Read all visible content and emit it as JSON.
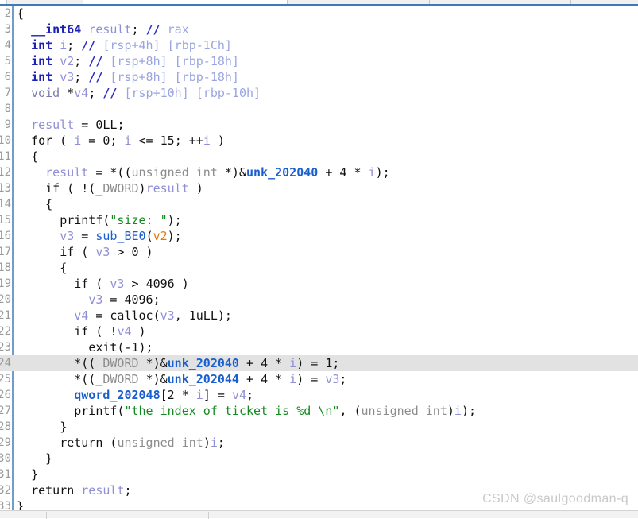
{
  "app": {
    "name": "ida-pseudocode-view",
    "accent_color": "#3a7cb8",
    "background": "#ffffff",
    "highlight_color": "#e2e2e2"
  },
  "topbar": {
    "present": true,
    "divider_color": "#c8c8c8",
    "underline_color": "#3a7cb8"
  },
  "bottombar": {
    "present": true,
    "divider_color": "#cfcfcf"
  },
  "editor": {
    "gutter_border_color": "#6f9fc8",
    "highlighted_line": 24,
    "first_visible_line": 2,
    "last_visible_line": 33
  },
  "watermark": {
    "text": "CSDN @saulgoodman-q",
    "color": "#c9c9c9"
  },
  "code_lines": [
    {
      "n": "2",
      "indent": 0,
      "tokens": [
        {
          "t": "{",
          "c": "ctl"
        }
      ]
    },
    {
      "n": "3",
      "indent": 2,
      "tokens": [
        {
          "t": "__int64",
          "c": "kw"
        },
        {
          "t": " ",
          "c": "pun"
        },
        {
          "t": "result",
          "c": "var"
        },
        {
          "t": ";",
          "c": "pun"
        },
        {
          "t": " ",
          "c": "pun"
        },
        {
          "t": "//",
          "c": "cmt"
        },
        {
          "t": " rax",
          "c": "cmtx"
        }
      ]
    },
    {
      "n": "4",
      "indent": 2,
      "tokens": [
        {
          "t": "int",
          "c": "kw"
        },
        {
          "t": " ",
          "c": "pun"
        },
        {
          "t": "i",
          "c": "var"
        },
        {
          "t": ";",
          "c": "pun"
        },
        {
          "t": " ",
          "c": "pun"
        },
        {
          "t": "//",
          "c": "cmt"
        },
        {
          "t": " [rsp+4h] [rbp-1Ch]",
          "c": "cmtx"
        }
      ]
    },
    {
      "n": "5",
      "indent": 2,
      "tokens": [
        {
          "t": "int",
          "c": "kw"
        },
        {
          "t": " ",
          "c": "pun"
        },
        {
          "t": "v2",
          "c": "var"
        },
        {
          "t": ";",
          "c": "pun"
        },
        {
          "t": " ",
          "c": "pun"
        },
        {
          "t": "//",
          "c": "cmt"
        },
        {
          "t": " [rsp+8h] [rbp-18h]",
          "c": "cmtx"
        }
      ]
    },
    {
      "n": "6",
      "indent": 2,
      "tokens": [
        {
          "t": "int",
          "c": "kw"
        },
        {
          "t": " ",
          "c": "pun"
        },
        {
          "t": "v3",
          "c": "var"
        },
        {
          "t": ";",
          "c": "pun"
        },
        {
          "t": " ",
          "c": "pun"
        },
        {
          "t": "//",
          "c": "cmt"
        },
        {
          "t": " [rsp+8h] [rbp-18h]",
          "c": "cmtx"
        }
      ]
    },
    {
      "n": "7",
      "indent": 2,
      "tokens": [
        {
          "t": "void",
          "c": "kw2"
        },
        {
          "t": " *",
          "c": "pun"
        },
        {
          "t": "v4",
          "c": "var"
        },
        {
          "t": ";",
          "c": "pun"
        },
        {
          "t": " ",
          "c": "pun"
        },
        {
          "t": "//",
          "c": "cmt"
        },
        {
          "t": " [rsp+10h] [rbp-10h]",
          "c": "cmtx"
        }
      ]
    },
    {
      "n": "8",
      "indent": 0,
      "tokens": []
    },
    {
      "n": "9",
      "indent": 2,
      "tokens": [
        {
          "t": "result",
          "c": "var"
        },
        {
          "t": " = ",
          "c": "pun"
        },
        {
          "t": "0LL",
          "c": "num"
        },
        {
          "t": ";",
          "c": "pun"
        }
      ]
    },
    {
      "n": "10",
      "indent": 2,
      "tokens": [
        {
          "t": "for",
          "c": "ctl"
        },
        {
          "t": " ( ",
          "c": "pun"
        },
        {
          "t": "i",
          "c": "var"
        },
        {
          "t": " = ",
          "c": "pun"
        },
        {
          "t": "0",
          "c": "num"
        },
        {
          "t": "; ",
          "c": "pun"
        },
        {
          "t": "i",
          "c": "var"
        },
        {
          "t": " <= ",
          "c": "pun"
        },
        {
          "t": "15",
          "c": "num"
        },
        {
          "t": "; ++",
          "c": "pun"
        },
        {
          "t": "i",
          "c": "var"
        },
        {
          "t": " )",
          "c": "pun"
        }
      ]
    },
    {
      "n": "11",
      "indent": 2,
      "tokens": [
        {
          "t": "{",
          "c": "ctl"
        }
      ]
    },
    {
      "n": "12",
      "indent": 4,
      "tokens": [
        {
          "t": "result",
          "c": "var"
        },
        {
          "t": " = *((",
          "c": "pun"
        },
        {
          "t": "unsigned int",
          "c": "typ"
        },
        {
          "t": " *)&",
          "c": "pun"
        },
        {
          "t": "unk_202040",
          "c": "glob"
        },
        {
          "t": " + ",
          "c": "pun"
        },
        {
          "t": "4",
          "c": "num"
        },
        {
          "t": " * ",
          "c": "pun"
        },
        {
          "t": "i",
          "c": "var"
        },
        {
          "t": ");",
          "c": "pun"
        }
      ]
    },
    {
      "n": "13",
      "indent": 4,
      "tokens": [
        {
          "t": "if",
          "c": "ctl"
        },
        {
          "t": " ( !(",
          "c": "pun"
        },
        {
          "t": "_DWORD",
          "c": "typ"
        },
        {
          "t": ")",
          "c": "pun"
        },
        {
          "t": "result",
          "c": "var"
        },
        {
          "t": " )",
          "c": "pun"
        }
      ]
    },
    {
      "n": "14",
      "indent": 4,
      "tokens": [
        {
          "t": "{",
          "c": "ctl"
        }
      ]
    },
    {
      "n": "15",
      "indent": 6,
      "tokens": [
        {
          "t": "printf",
          "c": "ctl"
        },
        {
          "t": "(",
          "c": "pun"
        },
        {
          "t": "\"size: \"",
          "c": "str"
        },
        {
          "t": ");",
          "c": "pun"
        }
      ]
    },
    {
      "n": "16",
      "indent": 6,
      "tokens": [
        {
          "t": "v3",
          "c": "var"
        },
        {
          "t": " = ",
          "c": "pun"
        },
        {
          "t": "sub_BE0",
          "c": "fn"
        },
        {
          "t": "(",
          "c": "pun"
        },
        {
          "t": "v2",
          "c": "varh"
        },
        {
          "t": ");",
          "c": "pun"
        }
      ]
    },
    {
      "n": "17",
      "indent": 6,
      "tokens": [
        {
          "t": "if",
          "c": "ctl"
        },
        {
          "t": " ( ",
          "c": "pun"
        },
        {
          "t": "v3",
          "c": "var"
        },
        {
          "t": " > ",
          "c": "pun"
        },
        {
          "t": "0",
          "c": "num"
        },
        {
          "t": " )",
          "c": "pun"
        }
      ]
    },
    {
      "n": "18",
      "indent": 6,
      "tokens": [
        {
          "t": "{",
          "c": "ctl"
        }
      ]
    },
    {
      "n": "19",
      "indent": 8,
      "tokens": [
        {
          "t": "if",
          "c": "ctl"
        },
        {
          "t": " ( ",
          "c": "pun"
        },
        {
          "t": "v3",
          "c": "var"
        },
        {
          "t": " > ",
          "c": "pun"
        },
        {
          "t": "4096",
          "c": "num"
        },
        {
          "t": " )",
          "c": "pun"
        }
      ]
    },
    {
      "n": "20",
      "indent": 10,
      "tokens": [
        {
          "t": "v3",
          "c": "var"
        },
        {
          "t": " = ",
          "c": "pun"
        },
        {
          "t": "4096",
          "c": "num"
        },
        {
          "t": ";",
          "c": "pun"
        }
      ]
    },
    {
      "n": "21",
      "indent": 8,
      "tokens": [
        {
          "t": "v4",
          "c": "var"
        },
        {
          "t": " = ",
          "c": "pun"
        },
        {
          "t": "calloc",
          "c": "ctl"
        },
        {
          "t": "(",
          "c": "pun"
        },
        {
          "t": "v3",
          "c": "var"
        },
        {
          "t": ", ",
          "c": "pun"
        },
        {
          "t": "1uLL",
          "c": "num"
        },
        {
          "t": ");",
          "c": "pun"
        }
      ]
    },
    {
      "n": "22",
      "indent": 8,
      "tokens": [
        {
          "t": "if",
          "c": "ctl"
        },
        {
          "t": " ( !",
          "c": "pun"
        },
        {
          "t": "v4",
          "c": "var"
        },
        {
          "t": " )",
          "c": "pun"
        }
      ]
    },
    {
      "n": "23",
      "indent": 10,
      "tokens": [
        {
          "t": "exit",
          "c": "ctl"
        },
        {
          "t": "(-",
          "c": "pun"
        },
        {
          "t": "1",
          "c": "num"
        },
        {
          "t": ");",
          "c": "pun"
        }
      ]
    },
    {
      "n": "24",
      "indent": 8,
      "highlight": true,
      "tokens": [
        {
          "t": "*((",
          "c": "pun"
        },
        {
          "t": "_DWORD",
          "c": "typ"
        },
        {
          "t": " *)&",
          "c": "pun"
        },
        {
          "t": "unk_202040",
          "c": "glob"
        },
        {
          "t": " + ",
          "c": "pun"
        },
        {
          "t": "4",
          "c": "num"
        },
        {
          "t": " * ",
          "c": "pun"
        },
        {
          "t": "i",
          "c": "var"
        },
        {
          "t": ") = ",
          "c": "pun"
        },
        {
          "t": "1",
          "c": "num"
        },
        {
          "t": ";",
          "c": "pun"
        }
      ]
    },
    {
      "n": "25",
      "indent": 8,
      "tokens": [
        {
          "t": "*((",
          "c": "pun"
        },
        {
          "t": "_DWORD",
          "c": "typ"
        },
        {
          "t": " *)&",
          "c": "pun"
        },
        {
          "t": "unk_202044",
          "c": "glob"
        },
        {
          "t": " + ",
          "c": "pun"
        },
        {
          "t": "4",
          "c": "num"
        },
        {
          "t": " * ",
          "c": "pun"
        },
        {
          "t": "i",
          "c": "var"
        },
        {
          "t": ") = ",
          "c": "pun"
        },
        {
          "t": "v3",
          "c": "var"
        },
        {
          "t": ";",
          "c": "pun"
        }
      ]
    },
    {
      "n": "26",
      "indent": 8,
      "tokens": [
        {
          "t": "qword_202048",
          "c": "glob"
        },
        {
          "t": "[",
          "c": "pun"
        },
        {
          "t": "2",
          "c": "num"
        },
        {
          "t": " * ",
          "c": "pun"
        },
        {
          "t": "i",
          "c": "var"
        },
        {
          "t": "] = ",
          "c": "pun"
        },
        {
          "t": "v4",
          "c": "var"
        },
        {
          "t": ";",
          "c": "pun"
        }
      ]
    },
    {
      "n": "27",
      "indent": 8,
      "tokens": [
        {
          "t": "printf",
          "c": "ctl"
        },
        {
          "t": "(",
          "c": "pun"
        },
        {
          "t": "\"the index of ticket is %d \\n\"",
          "c": "str"
        },
        {
          "t": ", (",
          "c": "pun"
        },
        {
          "t": "unsigned int",
          "c": "typ"
        },
        {
          "t": ")",
          "c": "pun"
        },
        {
          "t": "i",
          "c": "var"
        },
        {
          "t": ");",
          "c": "pun"
        }
      ]
    },
    {
      "n": "28",
      "indent": 6,
      "tokens": [
        {
          "t": "}",
          "c": "ctl"
        }
      ]
    },
    {
      "n": "29",
      "indent": 6,
      "tokens": [
        {
          "t": "return",
          "c": "ctl"
        },
        {
          "t": " (",
          "c": "pun"
        },
        {
          "t": "unsigned int",
          "c": "typ"
        },
        {
          "t": ")",
          "c": "pun"
        },
        {
          "t": "i",
          "c": "var"
        },
        {
          "t": ";",
          "c": "pun"
        }
      ]
    },
    {
      "n": "30",
      "indent": 4,
      "tokens": [
        {
          "t": "}",
          "c": "ctl"
        }
      ]
    },
    {
      "n": "31",
      "indent": 2,
      "tokens": [
        {
          "t": "}",
          "c": "ctl"
        }
      ]
    },
    {
      "n": "32",
      "indent": 2,
      "tokens": [
        {
          "t": "return",
          "c": "ctl"
        },
        {
          "t": " ",
          "c": "pun"
        },
        {
          "t": "result",
          "c": "var"
        },
        {
          "t": ";",
          "c": "pun"
        }
      ]
    },
    {
      "n": "33",
      "indent": 0,
      "tokens": [
        {
          "t": "}",
          "c": "ctl"
        }
      ]
    }
  ]
}
